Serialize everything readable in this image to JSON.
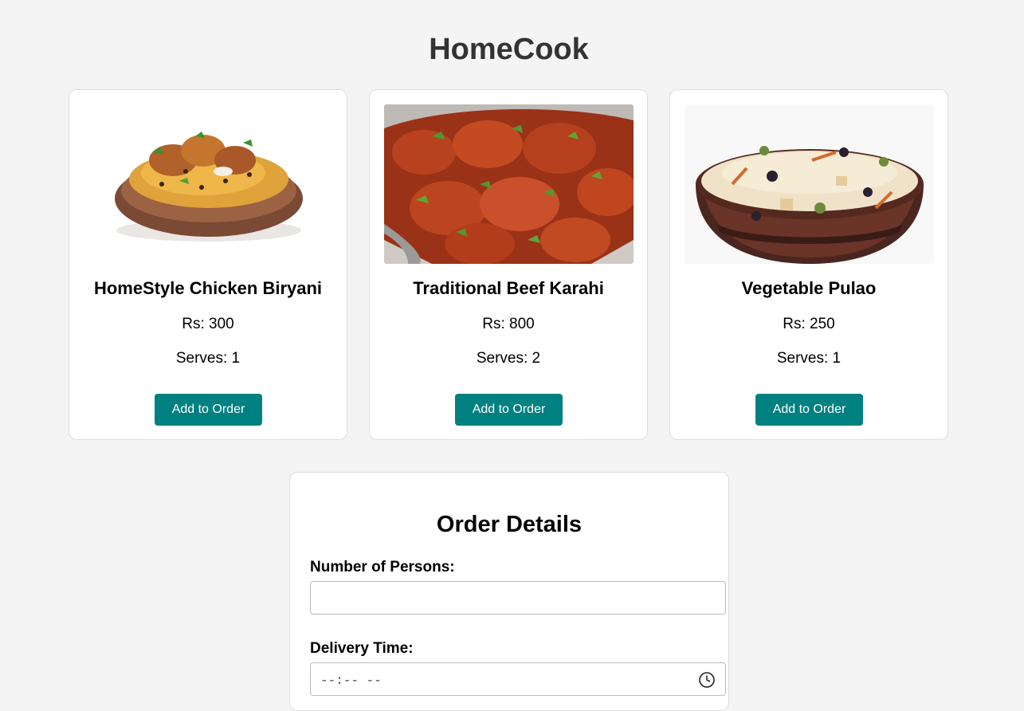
{
  "header": {
    "title": "HomeCook"
  },
  "menu": {
    "items": [
      {
        "name": "HomeStyle Chicken Biryani",
        "price": "Rs: 300",
        "serves": "Serves: 1",
        "button_label": "Add to Order",
        "image_icon": "chicken-biryani-photo"
      },
      {
        "name": "Traditional Beef Karahi",
        "price": "Rs: 800",
        "serves": "Serves: 2",
        "button_label": "Add to Order",
        "image_icon": "beef-karahi-photo"
      },
      {
        "name": "Vegetable Pulao",
        "price": "Rs: 250",
        "serves": "Serves: 1",
        "button_label": "Add to Order",
        "image_icon": "vegetable-pulao-photo"
      }
    ]
  },
  "order": {
    "title": "Order Details",
    "persons_label": "Number of Persons:",
    "persons_value": "",
    "time_label": "Delivery Time:",
    "time_value": "--:-- --"
  },
  "colors": {
    "accent": "#008080",
    "background": "#f4f4f4",
    "title": "#333333"
  }
}
